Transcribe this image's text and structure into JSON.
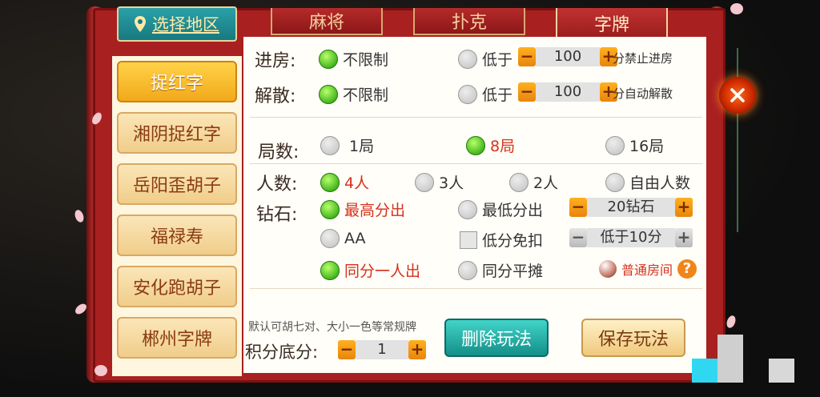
{
  "tabs": {
    "region": "选择地区",
    "items": [
      {
        "label": "麻将",
        "active": false
      },
      {
        "label": "扑克",
        "active": false
      },
      {
        "label": "字牌",
        "active": true
      }
    ]
  },
  "sidebar": {
    "items": [
      {
        "label": "捉红字",
        "active": true
      },
      {
        "label": "湘阴捉红字"
      },
      {
        "label": "岳阳歪胡子"
      },
      {
        "label": "福禄寿"
      },
      {
        "label": "安化跑胡子"
      },
      {
        "label": "郴州字牌"
      }
    ]
  },
  "settings": {
    "enter": {
      "label": "进房:",
      "opt_unlimited": "不限制",
      "opt_below": "低于",
      "value": "100",
      "suffix": "分禁止进房"
    },
    "dissolve": {
      "label": "解散:",
      "opt_unlimited": "不限制",
      "opt_below": "低于",
      "value": "100",
      "suffix": "分自动解散"
    },
    "rounds": {
      "label": "局数:",
      "options": [
        "1局",
        "8局",
        "16局"
      ],
      "selected": "8局"
    },
    "players": {
      "label": "人数:",
      "options": [
        "4人",
        "3人",
        "2人",
        "自由人数"
      ],
      "selected": "4人"
    },
    "diamond": {
      "label": "钻石:",
      "opt_highest": "最高分出",
      "opt_lowest": "最低分出",
      "amount": "20钻石",
      "opt_aa": "AA",
      "opt_low_exempt": "低分免扣",
      "threshold": "低于10分",
      "opt_tie_one": "同分一人出",
      "opt_tie_split": "同分平摊",
      "room_type": "普通房间",
      "help": "?"
    },
    "rules_note": "默认可胡七对、大小一色等常规牌",
    "base_score": {
      "label": "积分底分:",
      "value": "1"
    }
  },
  "buttons": {
    "delete": "删除玩法",
    "save": "保存玩法",
    "minus": "−",
    "plus": "+"
  },
  "colors": {
    "accent_red": "#a82020",
    "selected_text": "#d5311c",
    "teal": "#138f88",
    "gold": "#f2a91a"
  }
}
